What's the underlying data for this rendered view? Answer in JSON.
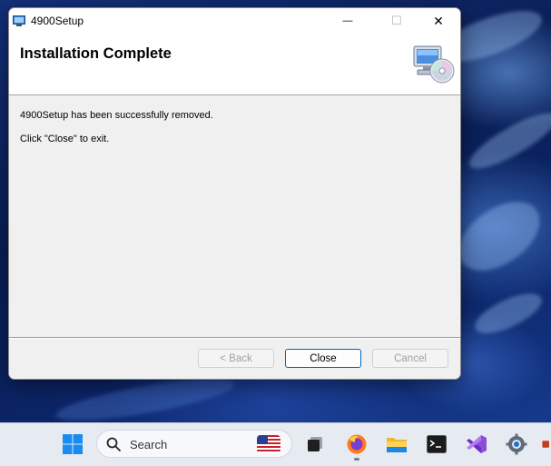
{
  "window": {
    "title": "4900Setup",
    "minimize_glyph": "—",
    "maximize_glyph": "☐",
    "close_glyph": "✕"
  },
  "banner": {
    "title": "Installation Complete",
    "icon": "computer-cd-icon"
  },
  "content": {
    "line1": "4900Setup has been successfully removed.",
    "line2": "Click \"Close\" to exit."
  },
  "buttons": {
    "back": "< Back",
    "close": "Close",
    "cancel": "Cancel"
  },
  "taskbar": {
    "search_placeholder": "Search",
    "apps": [
      "start-icon",
      "task-view-icon",
      "firefox-icon",
      "file-explorer-icon",
      "terminal-icon",
      "visual-studio-icon",
      "settings-icon",
      "powerpoint-icon"
    ]
  },
  "colors": {
    "accent": "#0067c0",
    "window_bg": "#f0f0f0",
    "taskbar_bg": "#e6ebf2"
  }
}
